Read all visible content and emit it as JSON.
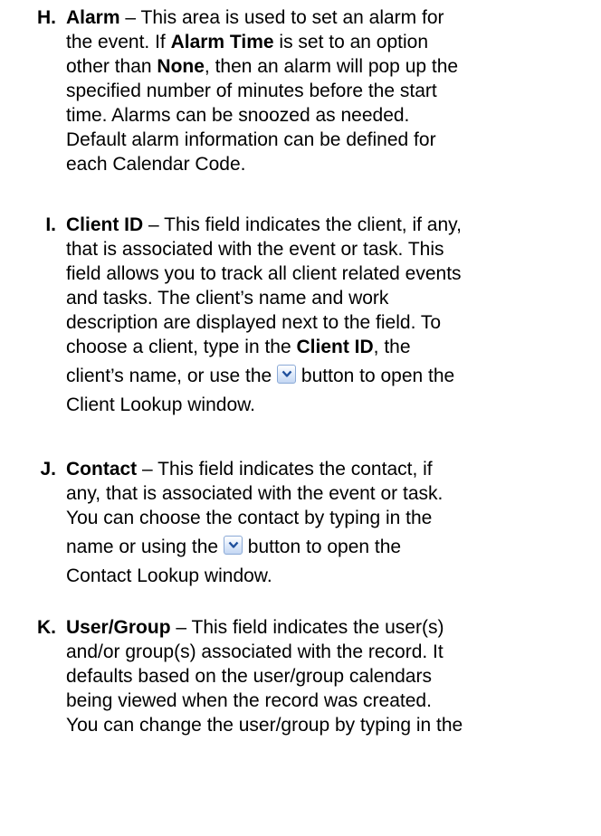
{
  "items": [
    {
      "marker": "H.",
      "term": "Alarm",
      "intro": " – This area is used to set an alarm for",
      "line2a": "the event. If ",
      "bold2": "Alarm Time",
      "line2b": " is set to an option",
      "line3a": "other than ",
      "bold3": "None",
      "line3b": ", then an alarm will pop up the",
      "line4": "specified number of minutes before the start",
      "line5": "time. Alarms can be snoozed as needed.",
      "line6": "Default alarm information can be defined for",
      "line7": "each Calendar Code."
    },
    {
      "marker": "I.",
      "term": "Client ID",
      "intro": " – This field indicates the client, if any,",
      "line2": "that is associated with the event or task. This",
      "line3": "field allows you to track all client related events",
      "line4": "and tasks. The client’s name and work",
      "line5": "description are displayed next to the field. To",
      "line6a": "choose a client, type in the ",
      "bold6": "Client ID",
      "line6b": ", the",
      "line7a": "client’s name, or use the ",
      "line7b": " button to open the",
      "line8": "Client Lookup window."
    },
    {
      "marker": "J.",
      "term": "Contact",
      "intro": " – This field indicates the contact, if",
      "line2": "any, that is associated with the event or task.",
      "line3": "You can choose the contact by typing in the",
      "line4a": "name or using the ",
      "line4b": " button to open the",
      "line5": "Contact Lookup window."
    },
    {
      "marker": "K.",
      "term": "User/Group",
      "intro": " – This field indicates the user(s)",
      "line2": "and/or group(s) associated with the record. It",
      "line3": "defaults based on the user/group calendars",
      "line4": "being viewed when the record was created.",
      "line5": "You can change the user/group by typing in the"
    }
  ],
  "icons": {
    "dropdown_button": "chevron-down-icon",
    "button_border": "#8aa9d6",
    "chevron_color": "#1e4f9c"
  }
}
